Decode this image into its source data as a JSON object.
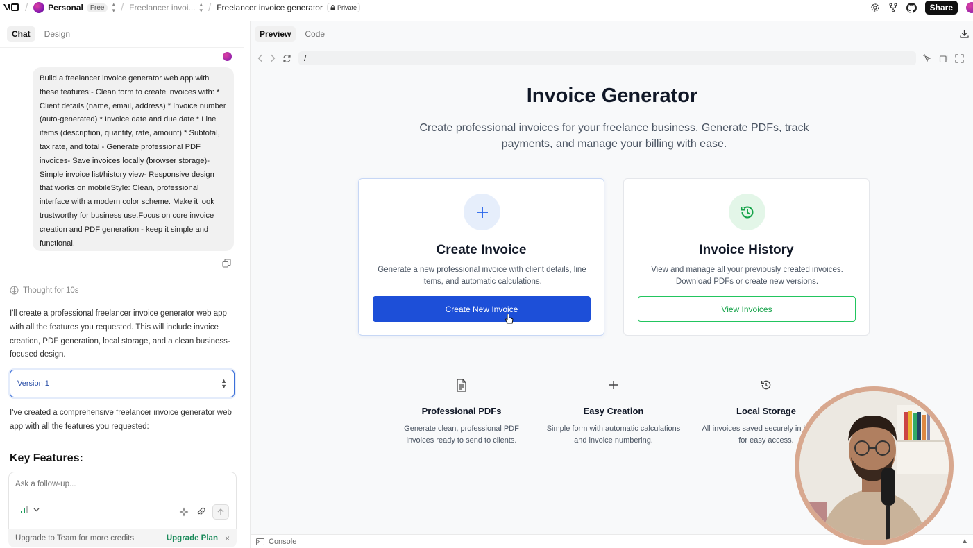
{
  "topbar": {
    "workspace": "Personal",
    "plan_badge": "Free",
    "project_short": "Freelancer invoi...",
    "project_name": "Freelancer invoice generator",
    "visibility": "Private",
    "share_label": "Share"
  },
  "left": {
    "tabs": [
      "Chat",
      "Design"
    ],
    "user_message": "Build a freelancer invoice generator web app with these features:- Clean form to create invoices with: * Client details (name, email, address) * Invoice number (auto-generated) * Invoice date and due date * Line items (description, quantity, rate, amount) * Subtotal, tax rate, and total - Generate professional PDF invoices- Save invoices locally (browser storage)- Simple invoice list/history view- Responsive design that works on mobileStyle: Clean, professional interface with a modern color scheme. Make it look trustworthy for business use.Focus on core invoice creation and PDF generation - keep it simple and functional.",
    "thought": "Thought for 10s",
    "assistant_intro": "I'll create a professional freelancer invoice generator web app with all the features you requested. This will include invoice creation, PDF generation, local storage, and a clean business-focused design.",
    "version": "Version 1",
    "assistant_summary": "I've created a comprehensive freelancer invoice generator web app with all the features you requested:",
    "key_features": "Key Features:",
    "composer_placeholder": "Ask a follow-up...",
    "upgrade_text": "Upgrade to Team for more credits",
    "upgrade_link": "Upgrade Plan",
    "upgrade_close": "×"
  },
  "right": {
    "tabs": [
      "Preview",
      "Code"
    ],
    "url": "/",
    "console_label": "Console"
  },
  "preview": {
    "title": "Invoice Generator",
    "subtitle": "Create professional invoices for your freelance business. Generate PDFs, track payments, and manage your billing with ease.",
    "cards": [
      {
        "icon": "plus-icon",
        "title": "Create Invoice",
        "description": "Generate a new professional invoice with client details, line items, and automatic calculations.",
        "button": "Create New Invoice"
      },
      {
        "icon": "history-icon",
        "title": "Invoice History",
        "description": "View and manage all your previously created invoices. Download PDFs or create new versions.",
        "button": "View Invoices"
      }
    ],
    "features": [
      {
        "icon": "document-icon",
        "title": "Professional PDFs",
        "description": "Generate clean, professional PDF invoices ready to send to clients."
      },
      {
        "icon": "plus-icon",
        "title": "Easy Creation",
        "description": "Simple form with automatic calculations and invoice numbering."
      },
      {
        "icon": "history-icon",
        "title": "Local Storage",
        "description": "All invoices saved securely in browser for easy access."
      }
    ]
  },
  "colors": {
    "primary_blue": "#1d4fd8",
    "success_green": "#16a34a",
    "upgrade_green": "#1a8a5a"
  }
}
